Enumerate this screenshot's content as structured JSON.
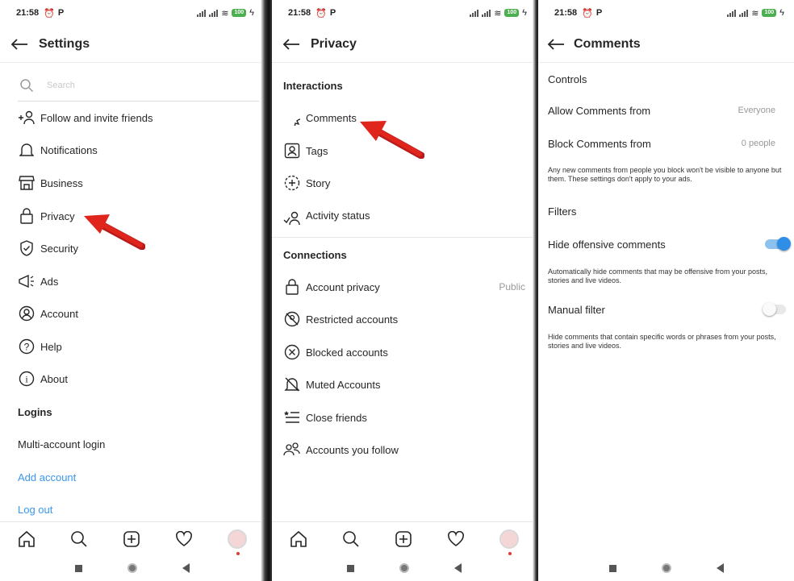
{
  "status": {
    "time": "21:58",
    "battery": "100"
  },
  "settings": {
    "title": "Settings",
    "search_placeholder": "Search",
    "items": [
      {
        "label": "Follow and invite friends",
        "icon": "add-person-icon"
      },
      {
        "label": "Notifications",
        "icon": "bell-icon"
      },
      {
        "label": "Business",
        "icon": "shop-icon"
      },
      {
        "label": "Privacy",
        "icon": "lock-icon"
      },
      {
        "label": "Security",
        "icon": "shield-icon"
      },
      {
        "label": "Ads",
        "icon": "megaphone-icon"
      },
      {
        "label": "Account",
        "icon": "account-circle-icon"
      },
      {
        "label": "Help",
        "icon": "help-icon"
      },
      {
        "label": "About",
        "icon": "info-icon"
      }
    ],
    "logins_header": "Logins",
    "multi_account": "Multi-account login",
    "add_account": "Add account",
    "log_out": "Log out"
  },
  "privacy": {
    "title": "Privacy",
    "interactions_header": "Interactions",
    "interactions": [
      {
        "label": "Comments",
        "icon": "comment-icon"
      },
      {
        "label": "Tags",
        "icon": "tag-person-icon"
      },
      {
        "label": "Story",
        "icon": "story-plus-icon"
      },
      {
        "label": "Activity status",
        "icon": "activity-status-icon"
      }
    ],
    "connections_header": "Connections",
    "connections": [
      {
        "label": "Account privacy",
        "icon": "lock-icon",
        "meta": "Public"
      },
      {
        "label": "Restricted accounts",
        "icon": "restricted-icon"
      },
      {
        "label": "Blocked accounts",
        "icon": "blocked-icon"
      },
      {
        "label": "Muted Accounts",
        "icon": "muted-bell-icon"
      },
      {
        "label": "Close friends",
        "icon": "close-friends-list-icon"
      },
      {
        "label": "Accounts you follow",
        "icon": "people-icon"
      }
    ]
  },
  "comments": {
    "title": "Comments",
    "controls_header": "Controls",
    "allow_label": "Allow Comments from",
    "allow_value": "Everyone",
    "block_label": "Block Comments from",
    "block_value": "0 people",
    "block_note": "Any new comments from people you block won't be visible to anyone but them. These settings don't apply to your ads.",
    "filters_header": "Filters",
    "hide_offensive_label": "Hide offensive comments",
    "hide_offensive_on": true,
    "hide_offensive_note": "Automatically hide comments that may be offensive from your posts, stories and live videos.",
    "manual_filter_label": "Manual filter",
    "manual_filter_on": false,
    "manual_filter_note": "Hide comments that contain specific words or phrases from your posts, stories and live videos."
  },
  "colors": {
    "link": "#3897f0",
    "arrow": "#e0261c",
    "toggle_on": "#2f8ee6"
  }
}
